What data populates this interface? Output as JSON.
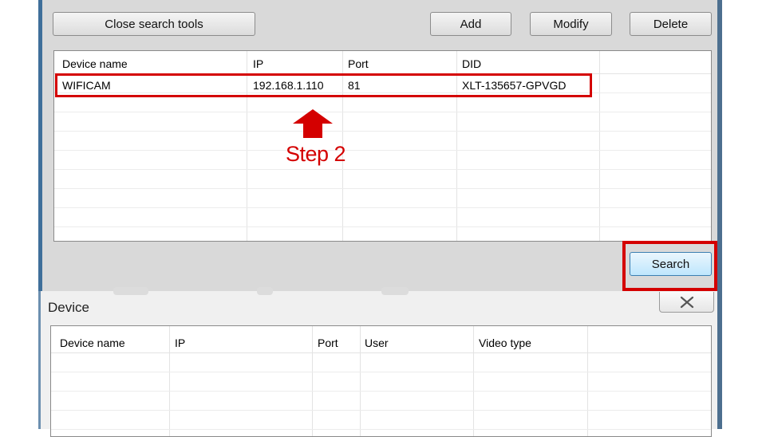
{
  "toolbar": {
    "close_search_tools": "Close search tools",
    "add": "Add",
    "modify": "Modify",
    "delete": "Delete",
    "search": "Search"
  },
  "search_table": {
    "columns": [
      "Device name",
      "IP",
      "Port",
      "DID"
    ],
    "rows": [
      {
        "device_name": "WIFICAM",
        "ip": "192.168.1.110",
        "port": "81",
        "did": "XLT-135657-GPVGD"
      }
    ]
  },
  "annotation": {
    "step_label": "Step 2",
    "color": "#d40000"
  },
  "device_dialog": {
    "title": "Device",
    "columns": [
      "Device name",
      "IP",
      "Port",
      "User",
      "Video type"
    ]
  }
}
